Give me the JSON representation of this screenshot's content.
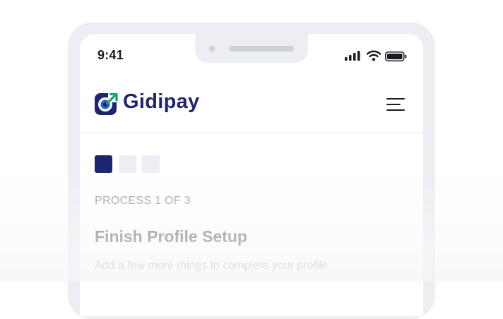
{
  "status_bar": {
    "time": "9:41",
    "icons": [
      "cellular-signal-icon",
      "wifi-icon",
      "battery-icon"
    ]
  },
  "header": {
    "logo_text": "Gidipay",
    "logo_icon": "gidipay-logo-icon",
    "menu_icon": "hamburger-menu-icon"
  },
  "progress": {
    "total_steps": 3,
    "current_step": 1,
    "label": "PROCESS 1 OF 3"
  },
  "section": {
    "title": "Finish Profile Setup",
    "subtitle": "Add a few more things to complete your profile"
  },
  "colors": {
    "brand_navy": "#1d2470",
    "accent_green": "#1aa56a",
    "accent_blue": "#2a66c8",
    "inactive_step": "#eceef3",
    "frame": "#eceef3"
  }
}
